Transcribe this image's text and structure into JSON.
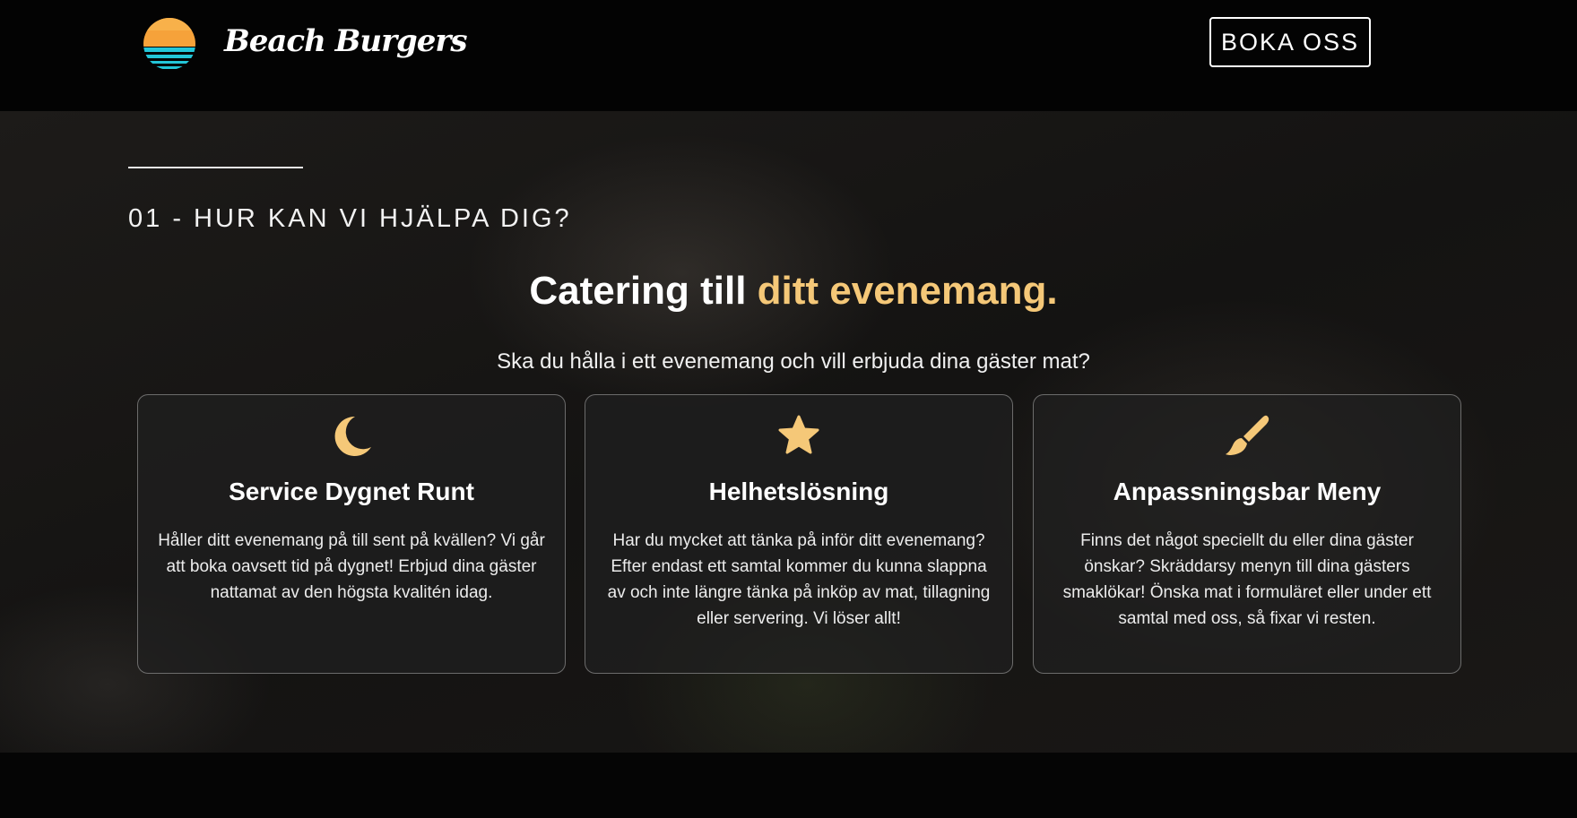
{
  "brand": {
    "name": "Beach Burgers",
    "logo_icon": "sunset-logo-icon"
  },
  "header": {
    "cta_label": "BOKA OSS"
  },
  "section": {
    "eyebrow": "01 - HUR KAN VI HJÄLPA DIG?",
    "title_main": "Catering till ",
    "title_accent": "ditt evenemang.",
    "subtitle": "Ska du hålla i ett evenemang och vill erbjuda dina gäster mat?"
  },
  "colors": {
    "accent": "#f5c878",
    "background": "#050505"
  },
  "cards": [
    {
      "icon": "moon-icon",
      "title": "Service Dygnet Runt",
      "text": "Håller ditt evenemang på till sent på kvällen? Vi går att boka oavsett tid på dygnet! Erbjud dina gäster nattamat av den högsta kvalitén idag."
    },
    {
      "icon": "star-icon",
      "title": "Helhetslösning",
      "text": "Har du mycket att tänka på inför ditt evenemang? Efter endast ett samtal kommer du kunna slappna av och inte längre tänka på inköp av mat, tillagning eller servering. Vi löser allt!"
    },
    {
      "icon": "paintbrush-icon",
      "title": "Anpassningsbar Meny",
      "text": "Finns det något speciellt du eller dina gäster önskar? Skräddarsy menyn till dina gästers smaklökar! Önska mat i formuläret eller under ett samtal med oss, så fixar vi resten."
    }
  ]
}
